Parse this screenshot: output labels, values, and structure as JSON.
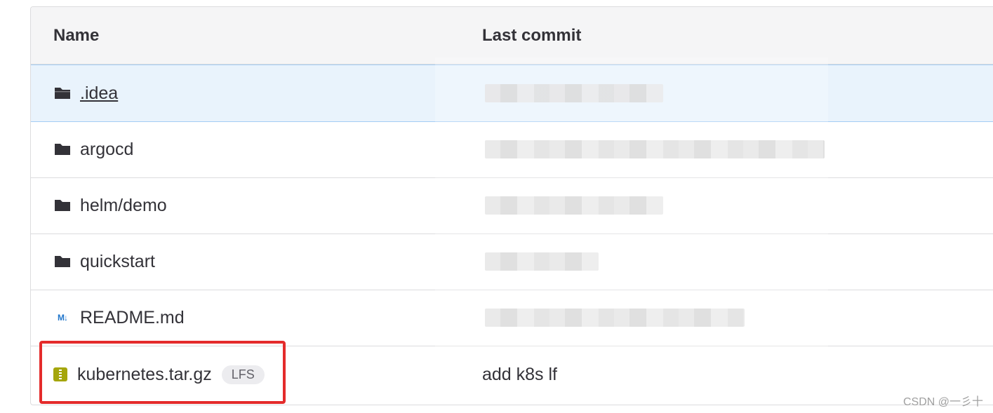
{
  "table": {
    "headers": {
      "name": "Name",
      "last_commit": "Last commit"
    },
    "rows": [
      {
        "icon": "folder-icon",
        "name": ".idea",
        "last_commit": "",
        "redacted": true
      },
      {
        "icon": "folder-icon",
        "name": "argocd",
        "last_commit": "",
        "redacted": true
      },
      {
        "icon": "folder-icon",
        "name": "helm/demo",
        "last_commit": "",
        "redacted": true
      },
      {
        "icon": "folder-icon",
        "name": "quickstart",
        "last_commit": "",
        "redacted": true
      },
      {
        "icon": "markdown-icon",
        "icon_text": "M↓",
        "name": "README.md",
        "last_commit": "",
        "redacted": true
      },
      {
        "icon": "archive-icon",
        "name": "kubernetes.tar.gz",
        "badge": "LFS",
        "last_commit": "add k8s lf"
      }
    ]
  },
  "annotation": {
    "highlight_color": "#e42b2b"
  },
  "watermark": "CSDN @一彡十",
  "colors": {
    "hover_row": "#e9f3fc",
    "header_bg": "#f5f5f6",
    "link_blue": "#1f75cb",
    "archive_icon": "#a5a60c"
  }
}
